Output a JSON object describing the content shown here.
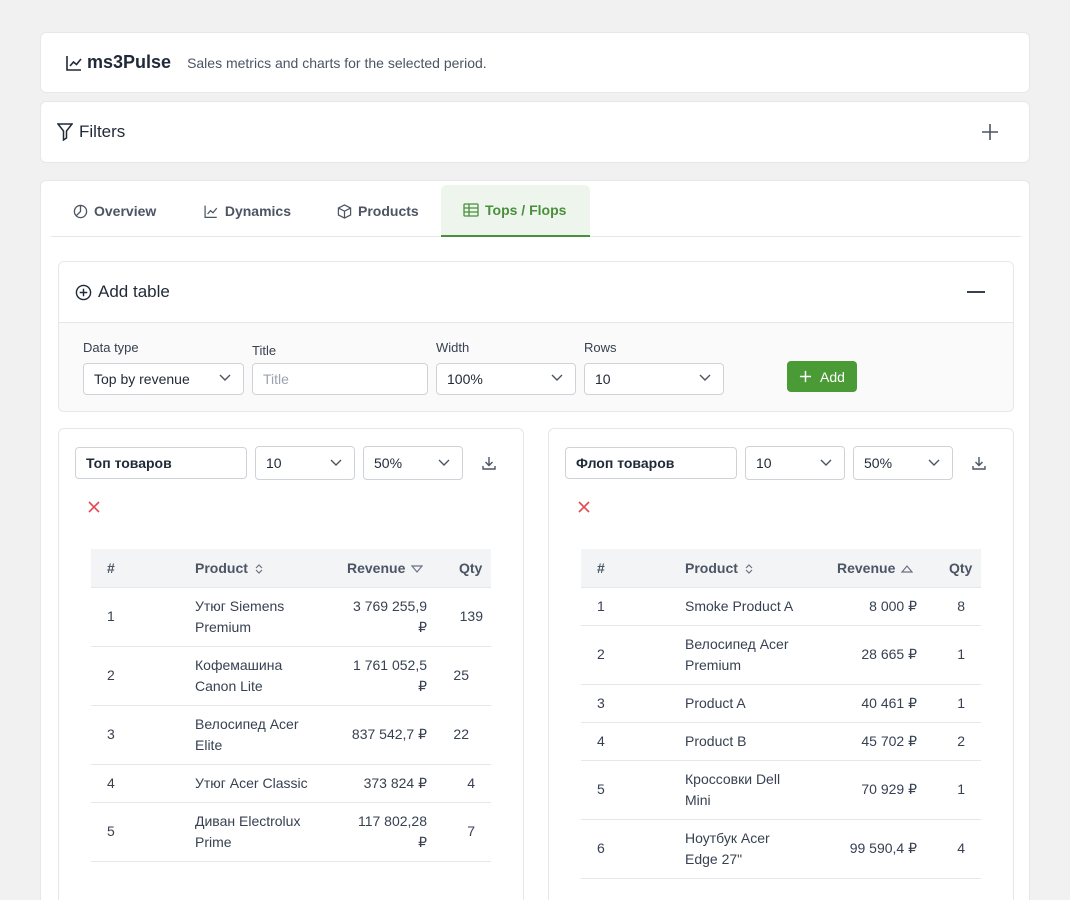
{
  "app": {
    "name": "ms3Pulse",
    "subtitle": "Sales metrics and charts for the selected period."
  },
  "filters": {
    "label": "Filters"
  },
  "tabs": [
    {
      "label": "Overview",
      "icon": "pie-chart-icon"
    },
    {
      "label": "Dynamics",
      "icon": "line-chart-icon"
    },
    {
      "label": "Products",
      "icon": "box-icon"
    },
    {
      "label": "Tops / Flops",
      "icon": "table-icon",
      "active": true
    }
  ],
  "add_table": {
    "title": "Add table",
    "data_type": {
      "label": "Data type",
      "value": "Top by revenue"
    },
    "title_field": {
      "label": "Title",
      "placeholder": "Title"
    },
    "width": {
      "label": "Width",
      "value": "100%"
    },
    "rows": {
      "label": "Rows",
      "value": "10"
    },
    "add_button": "Add"
  },
  "tables": [
    {
      "title": "Топ товаров",
      "rows_count": "10",
      "width": "50%",
      "columns": [
        "#",
        "Product",
        "Revenue",
        "Qty"
      ],
      "sort": "revenue-desc",
      "rows": [
        {
          "n": "1",
          "product": "Утюг Siemens Premium",
          "revenue": "3 769 255,9 ₽",
          "qty": "139"
        },
        {
          "n": "2",
          "product": "Кофемашина Canon Lite",
          "revenue": "1 761 052,5 ₽",
          "qty": "25"
        },
        {
          "n": "3",
          "product": "Велосипед Acer Elite",
          "revenue": "837 542,7 ₽",
          "qty": "22"
        },
        {
          "n": "4",
          "product": "Утюг Acer Classic",
          "revenue": "373 824 ₽",
          "qty": "4"
        },
        {
          "n": "5",
          "product": "Диван Electrolux Prime",
          "revenue": "117 802,28 ₽",
          "qty": "7"
        }
      ]
    },
    {
      "title": "Флоп товаров",
      "rows_count": "10",
      "width": "50%",
      "columns": [
        "#",
        "Product",
        "Revenue",
        "Qty"
      ],
      "sort": "revenue-asc",
      "rows": [
        {
          "n": "1",
          "product": "Smoke Product A",
          "revenue": "8 000 ₽",
          "qty": "8"
        },
        {
          "n": "2",
          "product": "Велосипед Acer Premium",
          "revenue": "28 665 ₽",
          "qty": "1"
        },
        {
          "n": "3",
          "product": "Product A",
          "revenue": "40 461 ₽",
          "qty": "1"
        },
        {
          "n": "4",
          "product": "Product B",
          "revenue": "45 702 ₽",
          "qty": "2"
        },
        {
          "n": "5",
          "product": "Кроссовки Dell Mini",
          "revenue": "70 929 ₽",
          "qty": "1"
        },
        {
          "n": "6",
          "product": "Ноутбук Acer Edge 27\"",
          "revenue": "99 590,4 ₽",
          "qty": "4"
        }
      ]
    }
  ],
  "colors": {
    "accent": "#4a9a36",
    "danger": "#e5484d"
  }
}
